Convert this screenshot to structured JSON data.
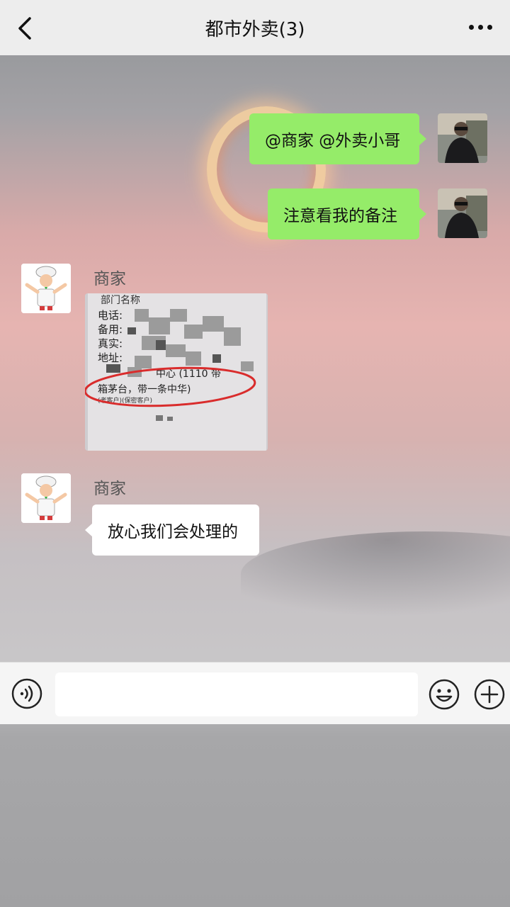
{
  "header": {
    "title": "都市外卖(3)"
  },
  "messages": [
    {
      "side": "right",
      "text": "@商家 @外卖小哥"
    },
    {
      "side": "right",
      "text": "注意看我的备注"
    },
    {
      "side": "left",
      "sender": "商家",
      "type": "image"
    },
    {
      "side": "left",
      "sender": "商家",
      "text": "放心我们会处理的"
    }
  ],
  "receipt": {
    "line1": "部门名称",
    "line2": "电话:",
    "line3": "备用:",
    "line4": "真实:",
    "line5": "地址:",
    "line6": "中心 (1110 带",
    "line7": "箱茅台，带一条中华)",
    "line8": "(老客户)(保密客户)"
  },
  "input": {
    "value": "",
    "placeholder": ""
  },
  "icons": {
    "back": "chevron-left-icon",
    "more": "more-dots-icon",
    "voice": "voice-icon",
    "emoji": "emoji-icon",
    "plus": "plus-icon"
  }
}
